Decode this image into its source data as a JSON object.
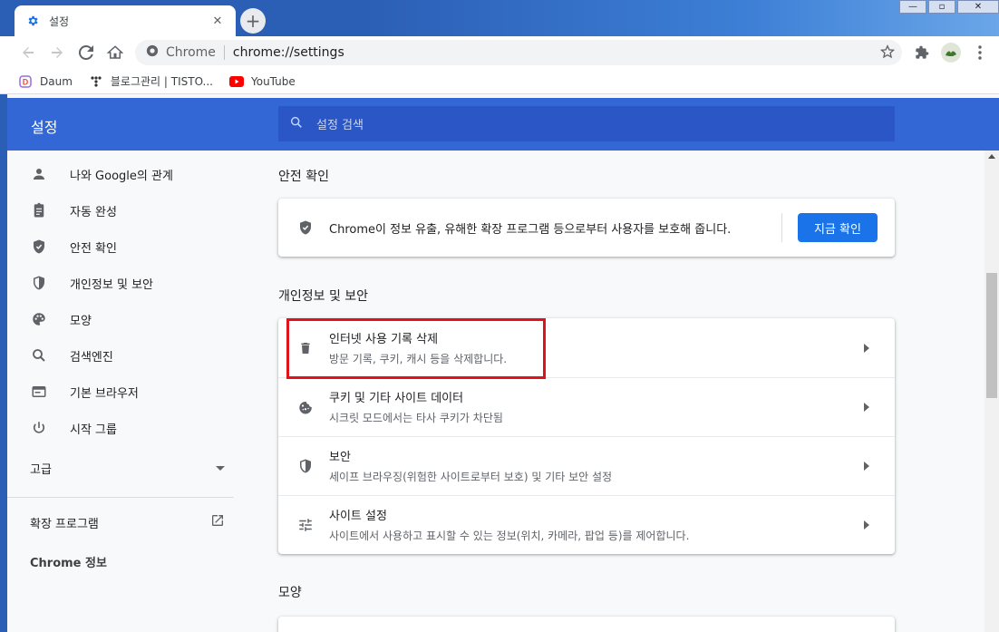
{
  "browser": {
    "tab_title": "설정",
    "omnibox_site": "Chrome",
    "omnibox_url": "chrome://settings"
  },
  "bookmarks": [
    {
      "label": "Daum",
      "icon": "daum-icon"
    },
    {
      "label": "블로그관리 | TISTO...",
      "icon": "tistory-icon"
    },
    {
      "label": "YouTube",
      "icon": "youtube-icon"
    }
  ],
  "header": {
    "title": "설정",
    "search_placeholder": "설정 검색"
  },
  "sidebar": {
    "items": [
      {
        "label": "나와 Google의 관계",
        "icon": "person-icon"
      },
      {
        "label": "자동 완성",
        "icon": "clipboard-icon"
      },
      {
        "label": "안전 확인",
        "icon": "shield-check-icon"
      },
      {
        "label": "개인정보 및 보안",
        "icon": "shield-icon"
      },
      {
        "label": "모양",
        "icon": "palette-icon"
      },
      {
        "label": "검색엔진",
        "icon": "search-icon"
      },
      {
        "label": "기본 브라우저",
        "icon": "browser-icon"
      },
      {
        "label": "시작 그룹",
        "icon": "power-icon"
      }
    ],
    "advanced": "고급",
    "extensions": "확장 프로그램",
    "about": "Chrome 정보"
  },
  "main": {
    "safety_check": {
      "section_title": "안전 확인",
      "description": "Chrome이 정보 유출, 유해한 확장 프로그램 등으로부터 사용자를 보호해 줍니다.",
      "button": "지금 확인"
    },
    "privacy": {
      "section_title": "개인정보 및 보안",
      "rows": [
        {
          "title": "인터넷 사용 기록 삭제",
          "subtitle": "방문 기록, 쿠키, 캐시 등을 삭제합니다.",
          "icon": "trash-icon"
        },
        {
          "title": "쿠키 및 기타 사이트 데이터",
          "subtitle": "시크릿 모드에서는 타사 쿠키가 차단됨",
          "icon": "cookie-icon"
        },
        {
          "title": "보안",
          "subtitle": "세이프 브라우징(위험한 사이트로부터 보호) 및 기타 보안 설정",
          "icon": "shield-icon"
        },
        {
          "title": "사이트 설정",
          "subtitle": "사이트에서 사용하고 표시할 수 있는 정보(위치, 카메라, 팝업 등)를 제어합니다.",
          "icon": "tune-icon"
        }
      ]
    },
    "appearance": {
      "section_title": "모양"
    }
  },
  "colors": {
    "header_blue": "#3367d6",
    "search_blue": "#2a56c6",
    "button_blue": "#1a73e8",
    "highlight_red": "#e0121b"
  }
}
